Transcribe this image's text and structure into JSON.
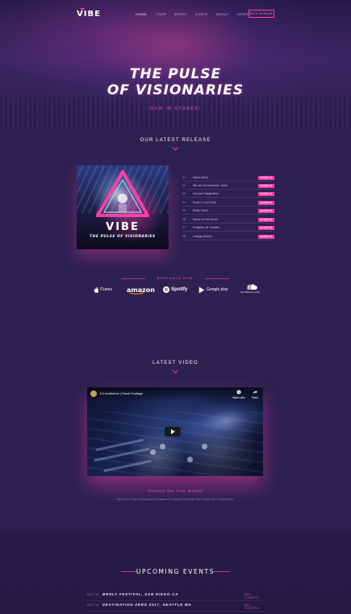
{
  "nav": {
    "logo_text": "VIBE",
    "links": [
      "Home",
      "Tour",
      "Music",
      "Video",
      "About",
      "News"
    ],
    "active_link": "Home",
    "cta": "Buy Album"
  },
  "hero": {
    "title_line1": "THE PULSE",
    "title_line2": "OF VISIONARIES",
    "subtitle": "Now in stores!"
  },
  "release": {
    "section_title": "Our latest release",
    "album": {
      "title": "VIBE",
      "subtitle": "THE PULSE OF VISIONARIES"
    },
    "tracks": [
      {
        "num": "01",
        "name": "Alpha (Intro)",
        "action": "SAMPLE"
      },
      {
        "num": "02",
        "name": "We are Ion Hearts (ft. Jade)",
        "action": "SAMPLE"
      },
      {
        "num": "03",
        "name": "Let your Imagination",
        "action": "SAMPLE"
      },
      {
        "num": "04",
        "name": "Power / Lord Guild",
        "action": "SAMPLE"
      },
      {
        "num": "05",
        "name": "Bottle Tones",
        "action": "SAMPLE"
      },
      {
        "num": "06",
        "name": "Dance on the Moon",
        "action": "SAMPLE"
      },
      {
        "num": "07",
        "name": "Enlighten (ft. Scarlet)",
        "action": "SAMPLE"
      },
      {
        "num": "08",
        "name": "Omega (Outro)",
        "action": "SAMPLE"
      }
    ],
    "available_now": "Available now",
    "stores": [
      {
        "name": "iTunes",
        "icon": "apple-icon"
      },
      {
        "name": "amazon",
        "icon": "amazon-smile-icon"
      },
      {
        "name": "Spotify",
        "icon": "spotify-icon"
      },
      {
        "name": "Google play",
        "icon": "google-play-icon"
      },
      {
        "name": "SOUNDCLOUD",
        "icon": "soundcloud-icon"
      }
    ]
  },
  "video": {
    "section_title": "Latest Video",
    "player_title": "DJ Audioriver | Stock Footage",
    "actions": [
      {
        "label": "Watch later",
        "icon": "clock-icon"
      },
      {
        "label": "Share",
        "icon": "share-icon"
      }
    ],
    "caption": "\"Dance on the Moon\"",
    "description": "Album The Pulse of Visionaries | Released 01 January | Remaster Vibe / Pulse 2017 Loud Records"
  },
  "events": {
    "section_title": "Upcoming Events",
    "items": [
      {
        "date": "OCT 10",
        "name": "BROLY FESTIVAL, SAN DIEGO CA",
        "action": "Buy Tickets"
      },
      {
        "date": "OCT 14",
        "name": "DESTINATION ZERO 2017, SEATTLE WA",
        "action": "Buy Tickets"
      }
    ]
  },
  "colors": {
    "accent": "#ff3fa4",
    "background": "#2c2150",
    "text": "#ffffff"
  }
}
